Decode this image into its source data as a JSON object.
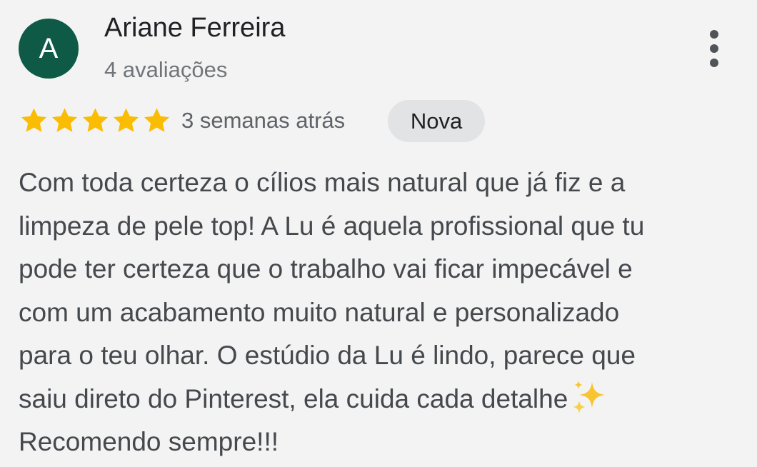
{
  "review": {
    "author": {
      "initial": "A",
      "name": "Ariane Ferreira",
      "meta": "4 avaliações"
    },
    "rating": {
      "value": 5,
      "max": 5,
      "star_color": "#fbbc04"
    },
    "date": "3 semanas atrás",
    "badge": "Nova",
    "text_lines": [
      "Com toda certeza o cílios mais natural que já fiz e a",
      "limpeza de pele top! A Lu é aquela profissional que tu",
      "pode ter certeza que o trabalho vai ficar impecável e",
      "com um acabamento muito natural e personalizado",
      "para o teu olhar. O estúdio da Lu é lindo, parece que",
      "saiu direto do Pinterest, ela cuida cada detalhe",
      "Recomendo sempre!!!"
    ],
    "emoji": "sparkles-icon",
    "more_icon": "more-vert-icon"
  },
  "colors": {
    "avatar_bg": "#0e5a47",
    "badge_bg": "#e2e3e5",
    "background": "#f3f3f3"
  }
}
